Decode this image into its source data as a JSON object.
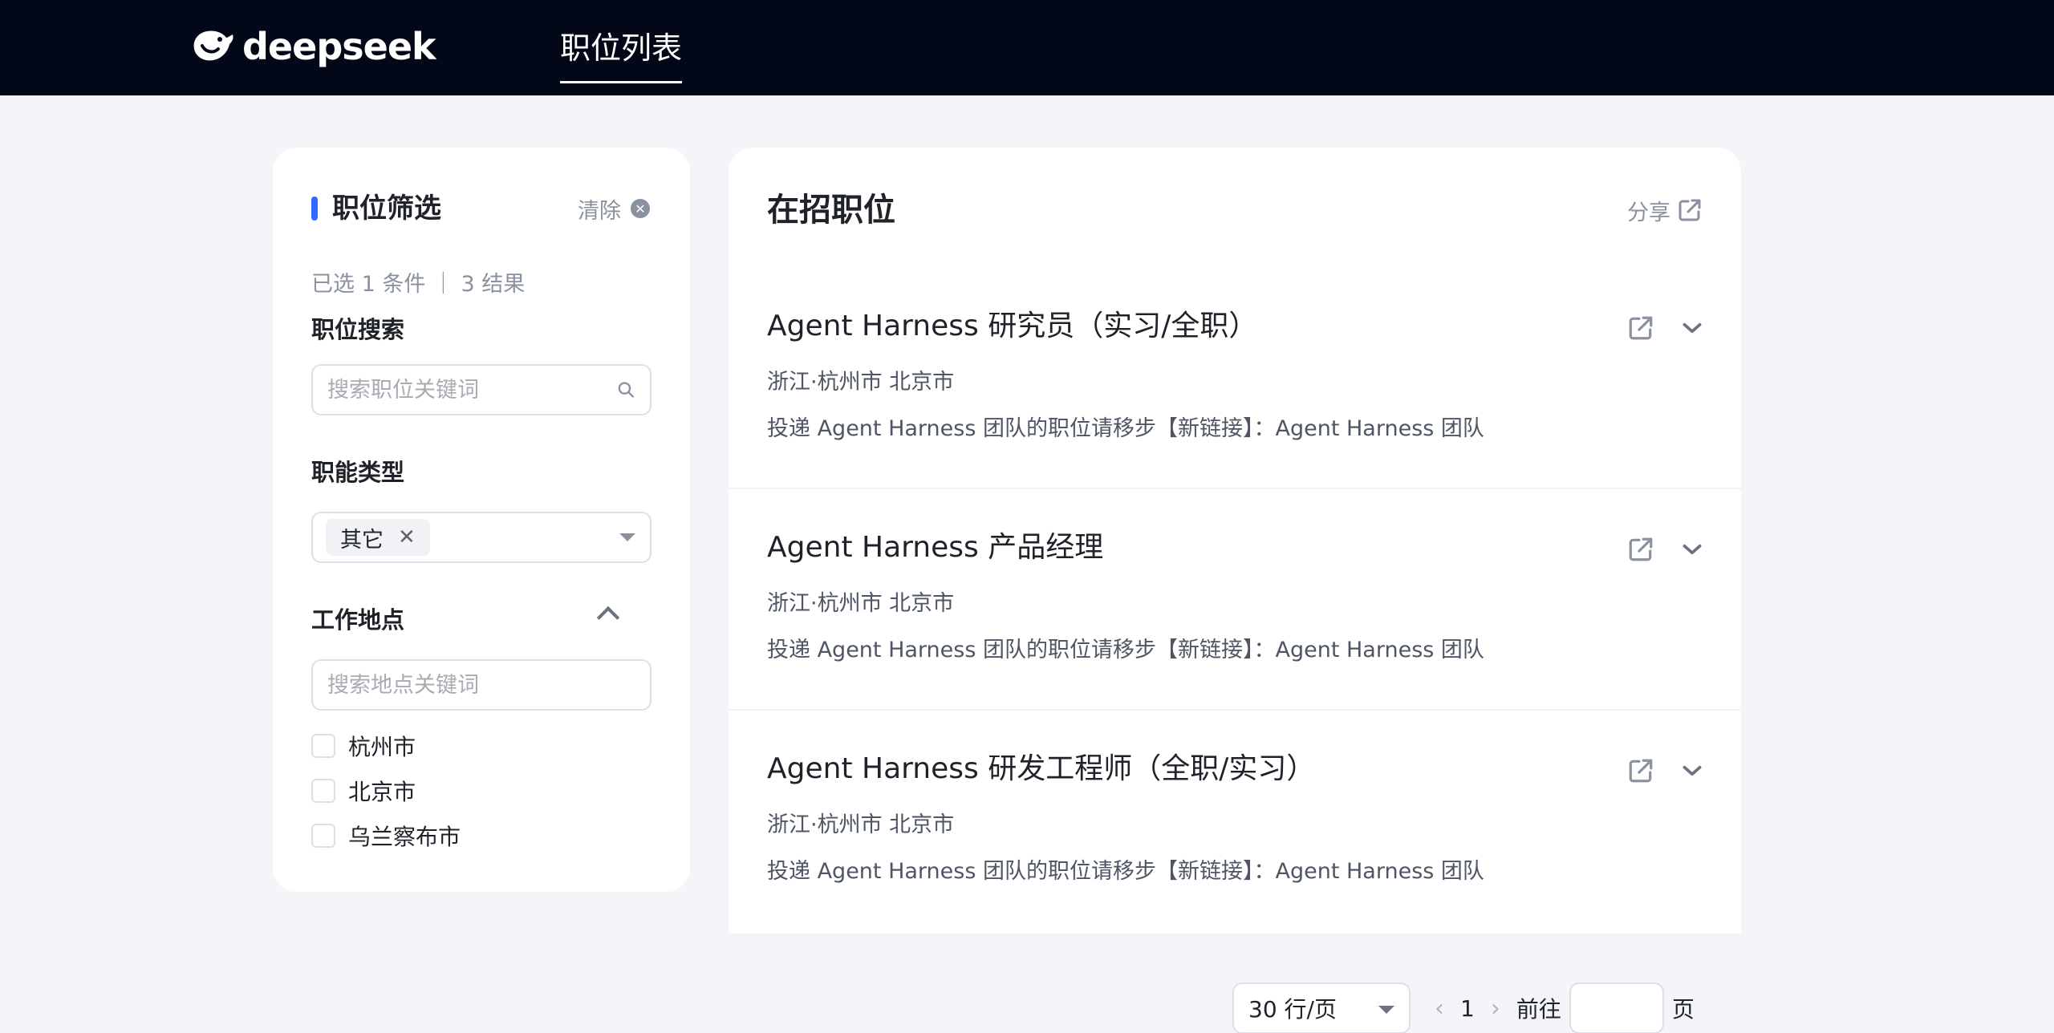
{
  "header": {
    "logo_text": "deepseek",
    "nav_tab": "职位列表"
  },
  "filter": {
    "title": "职位筛选",
    "clear_label": "清除",
    "summary": "已选 1 条件 ｜ 3 结果",
    "search_section": "职位搜索",
    "search_placeholder": "搜索职位关键词",
    "function_section": "职能类型",
    "selected_tag": "其它",
    "location_section": "工作地点",
    "location_placeholder": "搜索地点关键词",
    "locations": [
      "杭州市",
      "北京市",
      "乌兰察布市"
    ]
  },
  "jobs": {
    "title": "在招职位",
    "share_label": "分享",
    "items": [
      {
        "title": "Agent Harness 研究员（实习/全职）",
        "location": "浙江·杭州市 北京市",
        "description": "投递 Agent Harness 团队的职位请移步【新链接】：Agent Harness 团队"
      },
      {
        "title": "Agent Harness 产品经理",
        "location": "浙江·杭州市 北京市",
        "description": "投递 Agent Harness 团队的职位请移步【新链接】：Agent Harness 团队"
      },
      {
        "title": "Agent Harness 研发工程师（全职/实习）",
        "location": "浙江·杭州市 北京市",
        "description": "投递 Agent Harness 团队的职位请移步【新链接】：Agent Harness 团队"
      }
    ]
  },
  "pagination": {
    "page_size": "30 行/页",
    "current_page": "1",
    "goto_label": "前往",
    "page_unit": "页"
  },
  "colors": {
    "header_bg": "#020817",
    "accent": "#2f6bff",
    "page_bg": "#f4f5f9"
  }
}
